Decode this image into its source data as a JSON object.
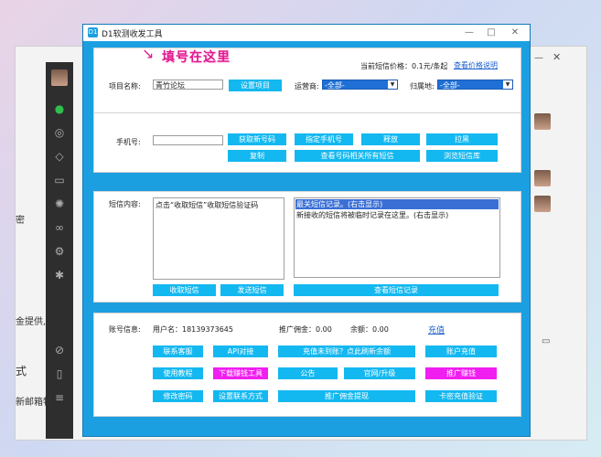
{
  "background": {
    "left_texts": [
      "密",
      "金提供,",
      "式",
      "新邮箱特"
    ],
    "right_icons": [
      "minimize-icon",
      "close-icon",
      "video-icon",
      "folder-icon"
    ]
  },
  "window": {
    "title": "D1软测收发工具",
    "logo_text": "D1"
  },
  "annotation": "填号在这里",
  "project": {
    "price_label": "当前短信价格：0.1元/条起",
    "price_link": "查看价格说明",
    "name_label": "项目名称:",
    "name_value": "青竹论坛",
    "set_button": "设置项目",
    "operator_label": "运营商:",
    "operator_value": "-全部-",
    "region_label": "归属地:",
    "region_value": "-全部-"
  },
  "phone": {
    "label": "手机号:",
    "value": "",
    "buttons": {
      "get_number": "获取新号码",
      "copy": "复制",
      "specify": "指定手机号",
      "release": "释放",
      "blacklist": "拉黑",
      "view_all_sms": "查看号码相关所有短信",
      "browse_sms": "浏览短信库"
    }
  },
  "sms": {
    "label": "短信内容:",
    "content": "点击“收取短信”收取短信验证码",
    "history_selected": "最关短信记录。(右击显示)",
    "history_line2": "新接收的短信将被临时记录在这里。(右击显示)",
    "receive_button": "收取短信",
    "send_button": "发送短信",
    "view_history_button": "查看短信记录"
  },
  "account": {
    "label": "账号信息:",
    "username": "用户名：18139373645",
    "commission": "推广佣金：0.00",
    "balance": "余额：0.00",
    "recharge_link": "充值",
    "buttons": {
      "contact": "联系客服",
      "api": "API对接",
      "recharge_not_arrived": "充值未到账？点此刷新余额",
      "account_recharge": "账户充值",
      "tutorial": "使用教程",
      "download_earn": "下载赚钱工具",
      "notice": "公告",
      "website_upgrade": "官网/升级",
      "promote_earn": "推广赚钱",
      "change_password": "修改密码",
      "set_contact": "设置联系方式",
      "withdraw_commission": "推广佣金提现",
      "card_recharge": "卡密充值验证"
    }
  },
  "colors": {
    "frame_blue": "#1c9fe0",
    "button_cyan": "#14b8f0",
    "button_magenta": "#f01ef0",
    "select_blue": "#1f6fd6",
    "annotation_pink": "#e0198f"
  }
}
